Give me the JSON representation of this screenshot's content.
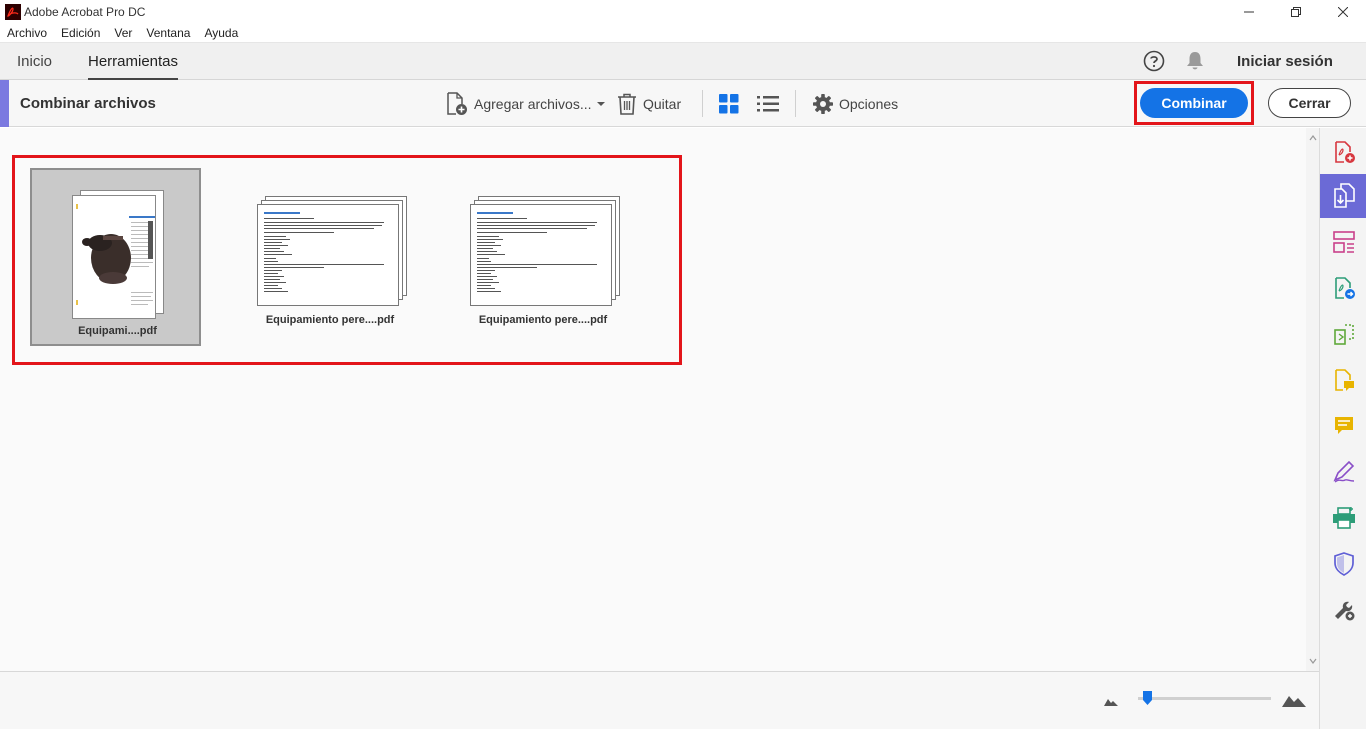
{
  "window": {
    "title": "Adobe Acrobat Pro DC"
  },
  "menu": [
    "Archivo",
    "Edición",
    "Ver",
    "Ventana",
    "Ayuda"
  ],
  "tabs": [
    {
      "label": "Inicio",
      "active": false
    },
    {
      "label": "Herramientas",
      "active": true
    }
  ],
  "header": {
    "signin_label": "Iniciar sesión"
  },
  "toolbar": {
    "title": "Combinar archivos",
    "add_label": "Agregar archivos...",
    "remove_label": "Quitar",
    "options_label": "Opciones",
    "combine_label": "Combinar",
    "close_label": "Cerrar"
  },
  "files": [
    {
      "name": "Equipami....pdf",
      "selected": true
    },
    {
      "name": "Equipamiento pere....pdf",
      "selected": false
    },
    {
      "name": "Equipamiento pere....pdf",
      "selected": false
    }
  ],
  "zoom": {
    "level": 0.04
  },
  "colors": {
    "accent": "#1473e6",
    "highlight": "#e3151a",
    "panel_active": "#6b6ad6"
  },
  "right_panel_icons": [
    "create-pdf-icon",
    "combine-files-icon",
    "organize-pages-icon",
    "export-pdf-icon",
    "edit-pdf-icon",
    "comment-file-icon",
    "comment-icon",
    "fill-sign-icon",
    "print-production-icon",
    "protect-icon",
    "more-tools-icon"
  ]
}
